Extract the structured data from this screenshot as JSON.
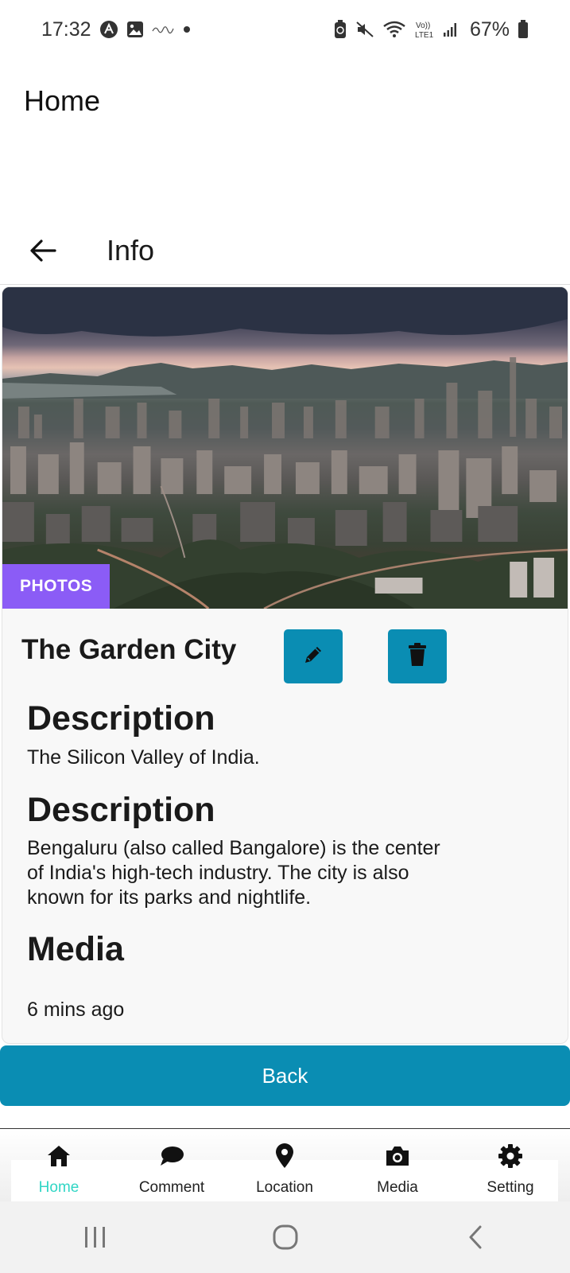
{
  "status_bar": {
    "time": "17:32",
    "battery": "67%",
    "left_icons": [
      "nfc-icon",
      "gallery-icon",
      "signature-icon",
      "dot-icon"
    ],
    "right_icons": [
      "battery-saver-icon",
      "mute-icon",
      "wifi-icon",
      "volte-icon",
      "signal-icon",
      "battery-icon"
    ]
  },
  "header": {
    "title": "Home"
  },
  "subheader": {
    "title": "Info",
    "back_icon": "arrow-left-icon"
  },
  "card": {
    "badge": "PHOTOS",
    "title": "The Garden City",
    "edit_icon": "pencil-icon",
    "delete_icon": "trash-icon",
    "sections": [
      {
        "heading": "Description",
        "text": "The Silicon Valley of India."
      },
      {
        "heading": "Description",
        "text": "Bengaluru (also called Bangalore) is the center of India's high-tech industry. The city is also known for its parks and nightlife."
      }
    ],
    "media_heading": "Media",
    "timestamp": "6 mins ago"
  },
  "back_button": {
    "label": "Back"
  },
  "bottom_nav": {
    "items": [
      {
        "label": "Home",
        "icon": "home-icon",
        "active": true
      },
      {
        "label": "Comment",
        "icon": "comment-icon",
        "active": false
      },
      {
        "label": "Location",
        "icon": "location-pin-icon",
        "active": false
      },
      {
        "label": "Media",
        "icon": "camera-icon",
        "active": false
      },
      {
        "label": "Setting",
        "icon": "gear-icon",
        "active": false
      }
    ]
  },
  "colors": {
    "accent": "#0a8db3",
    "badge": "#8b5cf6",
    "active_tab": "#31d6c5"
  },
  "system_nav": {
    "icons": [
      "recents-icon",
      "home-circle-icon",
      "back-chevron-icon"
    ]
  }
}
